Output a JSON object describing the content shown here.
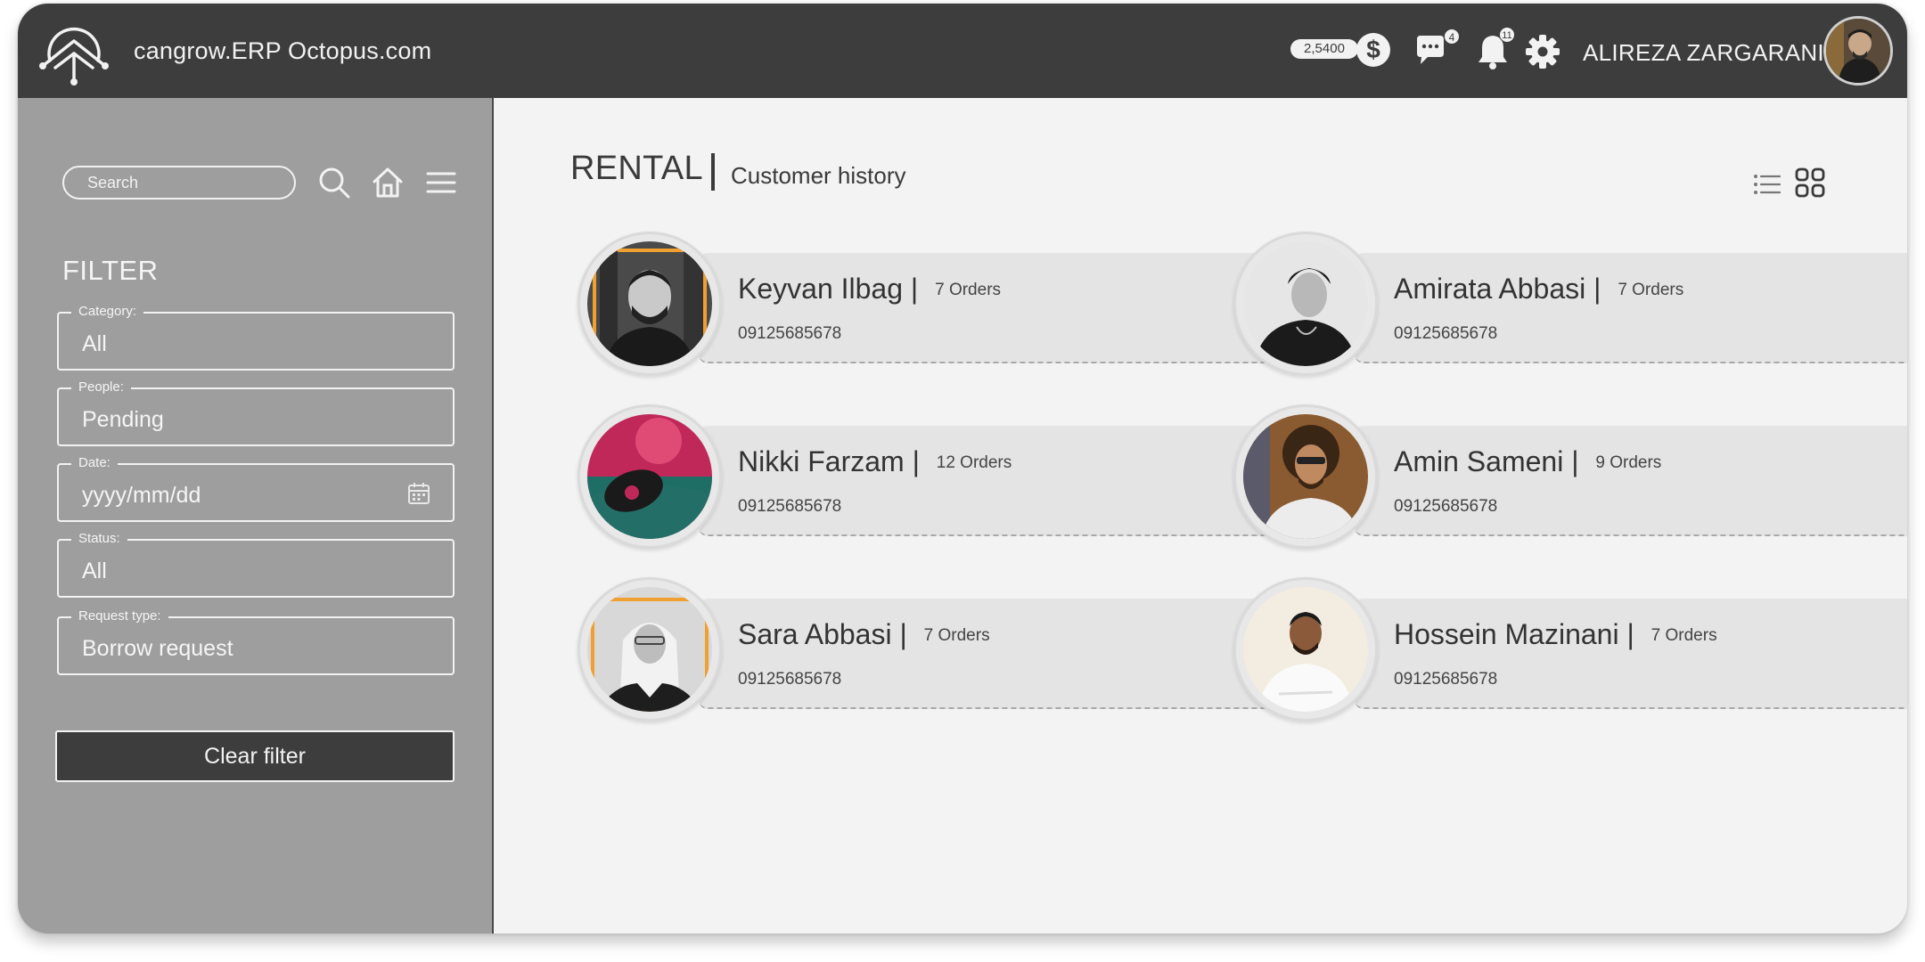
{
  "header": {
    "app_title": "cangrow.ERP Octopus.com",
    "balance": "2,5400",
    "currency_symbol": "$",
    "messages_count": "4",
    "notifications_count": "11",
    "user_name": "ALIREZA ZARGARANI",
    "icons": [
      "logo-icon",
      "dollar-icon",
      "chat-icon",
      "bell-icon",
      "gear-icon"
    ]
  },
  "sidebar": {
    "search_placeholder": "Search",
    "filter_title": "FILTER",
    "fields": [
      {
        "label": "Category:",
        "value": "All"
      },
      {
        "label": "People:",
        "value": "Pending"
      },
      {
        "label": "Date:",
        "value": "yyyy/mm/dd"
      },
      {
        "label": "Status:",
        "value": "All"
      },
      {
        "label": "Request type:",
        "value": "Borrow request"
      }
    ],
    "clear_button": "Clear filter"
  },
  "main": {
    "title": "RENTAL",
    "subtitle": "Customer history",
    "customers": [
      {
        "name": "Keyvan Ilbag",
        "orders": "7 Orders",
        "phone": "09125685678"
      },
      {
        "name": "Amirata Abbasi",
        "orders": "7 Orders",
        "phone": "09125685678"
      },
      {
        "name": "Nikki Farzam",
        "orders": "12 Orders",
        "phone": "09125685678"
      },
      {
        "name": "Amin Sameni",
        "orders": "9 Orders",
        "phone": "09125685678"
      },
      {
        "name": "Sara Abbasi",
        "orders": "7 Orders",
        "phone": "09125685678"
      },
      {
        "name": "Hossein Mazinani",
        "orders": "7 Orders",
        "phone": "09125685678"
      }
    ]
  },
  "colors": {
    "header_bg": "#3d3d3d",
    "sidebar_bg": "#9e9e9e",
    "content_bg": "#f3f3f3",
    "card_bg": "#e4e4e4",
    "accent_orange": "#f0a030"
  }
}
